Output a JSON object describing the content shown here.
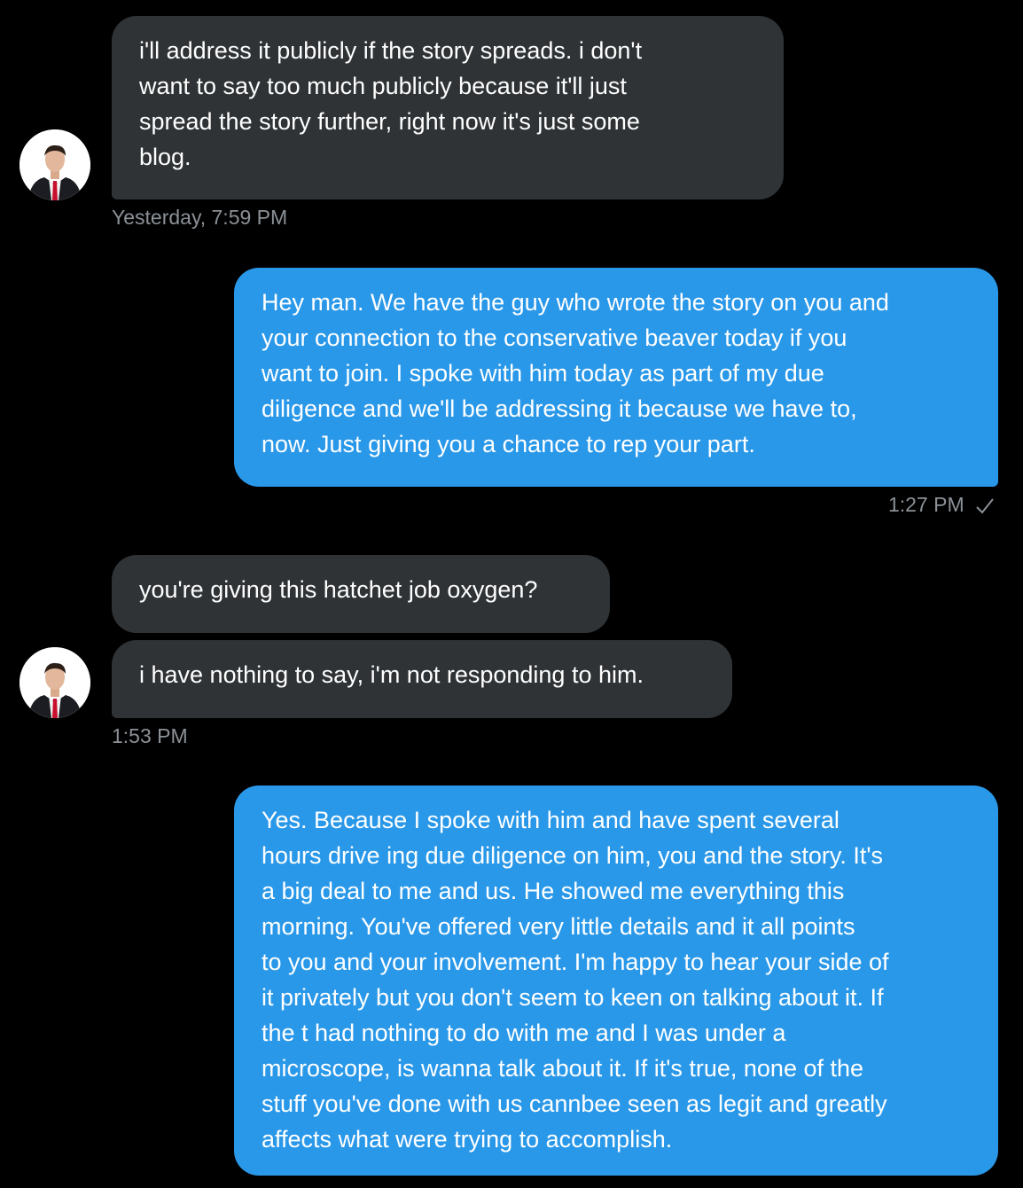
{
  "messages": [
    {
      "lines": [
        "i'll address it publicly if the story spreads. i don't",
        "want to say too much publicly because it'll just",
        "spread the story further, right now it's just some",
        "blog."
      ]
    },
    {
      "lines": [
        "Hey man.  We have the guy who wrote the story on you and",
        "your connection to the conservative beaver today if you",
        "want to join.  I spoke with him today as part of my due",
        "diligence and we'll be addressing it because we have to,",
        "now.  Just giving you a chance to rep your part."
      ]
    },
    {
      "lines": [
        "you're giving this hatchet job oxygen?"
      ]
    },
    {
      "lines": [
        "i have nothing to say, i'm not responding to him."
      ]
    },
    {
      "lines": [
        "Yes. Because I spoke with him and have spent several",
        "hours drive ing due diligence on him, you and the story.  It's",
        "a big deal to me and us.  He showed me everything this",
        "morning.  You've offered very little details and it all points",
        "to you and your involvement.  I'm happy to hear your side of",
        "it privately but you don't seem to keen on talking about it. If",
        "the t had nothing to do with me and I was under a",
        "microscope, is wanna talk about it. If it's true, none of the",
        "stuff you've done with us cannbee seen as legit and greatly",
        "affects what were trying to accomplish."
      ]
    }
  ],
  "timestamps": {
    "first": "Yesterday, 7:59 PM",
    "second": "1:27 PM",
    "third": "1:53 PM"
  },
  "icons": {
    "read_receipt": "checkmark-icon",
    "avatar": "contact-avatar"
  },
  "colors": {
    "background": "#000000",
    "incoming_bubble": "#2f3336",
    "outgoing_bubble": "#2a98e9",
    "timestamp": "#8b9197",
    "text": "#ffffff"
  }
}
